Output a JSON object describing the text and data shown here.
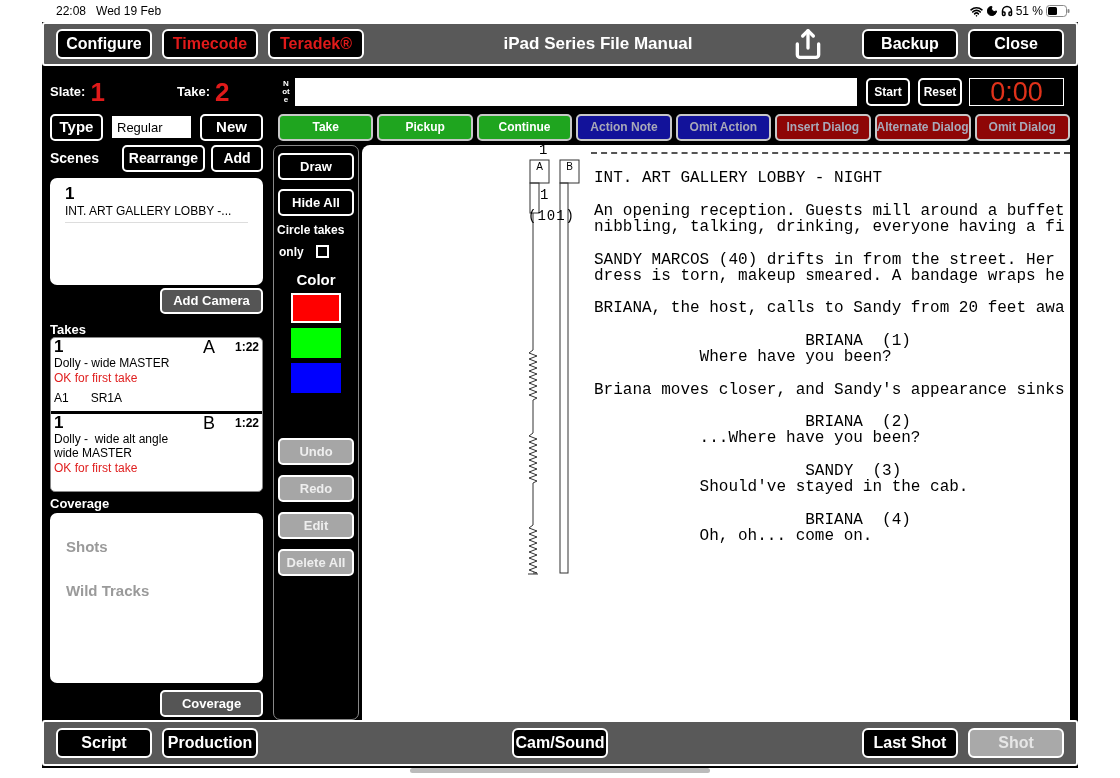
{
  "status_bar": {
    "time": "22:08",
    "date": "Wed 19 Feb",
    "battery": "51 %"
  },
  "toolbar": {
    "left_buttons": [
      {
        "label": "Configure",
        "alert": false
      },
      {
        "label": "Timecode",
        "alert": true
      },
      {
        "label": "Teradek®",
        "alert": true
      }
    ],
    "title": "iPad Series File Manual",
    "right_buttons": [
      "Backup",
      "Close"
    ]
  },
  "slate": {
    "label": "Slate:",
    "value": "1"
  },
  "take": {
    "label": "Take:",
    "value": "2"
  },
  "note": {
    "label": "Note"
  },
  "timer": {
    "buttons": [
      "Start",
      "Reset"
    ],
    "display": "0:00"
  },
  "type": {
    "button": "Type",
    "value": "Regular",
    "new_button": "New"
  },
  "categories": [
    {
      "label": "Take",
      "color": "#1fa51f",
      "disabled": false
    },
    {
      "label": "Pickup",
      "color": "#1fa51f",
      "disabled": false
    },
    {
      "label": "Continue",
      "color": "#1fa51f",
      "disabled": false
    },
    {
      "label": "Action Note",
      "color": "#12129a",
      "disabled": true
    },
    {
      "label": "Omit Action",
      "color": "#12129a",
      "disabled": true
    },
    {
      "label": "Insert Dialog",
      "color": "#8e0606",
      "disabled": true
    },
    {
      "label": "Alternate Dialog",
      "color": "#8e0606",
      "disabled": true
    },
    {
      "label": "Omit Dialog",
      "color": "#8e0606",
      "disabled": true
    }
  ],
  "scenes": {
    "label": "Scenes",
    "buttons": [
      "Rearrange",
      "Add"
    ],
    "items": [
      {
        "number": "1",
        "title": "INT. ART GALLERY LOBBY -..."
      }
    ],
    "add_camera": "Add Camera"
  },
  "takes": {
    "label": "Takes",
    "items": [
      {
        "scene": "1",
        "camera": "A",
        "duration": "1:22",
        "description": [
          "Dolly - wide MASTER"
        ],
        "note": "OK for first take",
        "details": [
          "A1",
          "SR1A"
        ]
      },
      {
        "scene": "1",
        "camera": "B",
        "duration": "1:22",
        "description": [
          "Dolly -  wide alt angle",
          "wide MASTER"
        ],
        "note": "OK for first take"
      }
    ]
  },
  "coverage": {
    "label": "Coverage",
    "items": [
      "Shots",
      "Wild Tracks"
    ],
    "button": "Coverage"
  },
  "tools": {
    "top_buttons": [
      "Draw",
      "Hide All"
    ],
    "circle_takes": {
      "label": "Circle takes",
      "label_2": "only",
      "checked": false
    },
    "color_label": "Color",
    "colors": [
      {
        "color": "#ff0000",
        "selected": true
      },
      {
        "color": "#00ff00",
        "selected": false
      },
      {
        "color": "#0000ff",
        "selected": false
      }
    ],
    "edit_buttons": [
      {
        "label": "Undo",
        "disabled": true
      },
      {
        "label": "Redo",
        "disabled": true
      },
      {
        "label": "Edit",
        "disabled": true
      },
      {
        "label": "Delete All",
        "disabled": true
      }
    ]
  },
  "lining": {
    "setup_number": "1",
    "columns": [
      {
        "label": "A"
      },
      {
        "label": "B"
      }
    ],
    "take_number": "1",
    "scene_number": "(101)"
  },
  "script": [
    {
      "kind": "heading",
      "lines": [
        "INT. ART GALLERY LOBBY - NIGHT"
      ]
    },
    {
      "kind": "action",
      "lines": [
        "An opening reception. Guests mill around a buffet",
        "nibbling, talking, drinking, everyone having a fi"
      ]
    },
    {
      "kind": "action",
      "lines": [
        "SANDY MARCOS (40) drifts in from the street. Her",
        "dress is torn, makeup smeared. A bandage wraps he"
      ]
    },
    {
      "kind": "action",
      "lines": [
        "BRIANA, the host, calls to Sandy from 20 feet awa"
      ]
    },
    {
      "kind": "character",
      "lines": [
        "BRIANA  (1)"
      ]
    },
    {
      "kind": "dialogue",
      "lines": [
        "Where have you been?"
      ]
    },
    {
      "kind": "action",
      "lines": [
        "Briana moves closer, and Sandy's appearance sinks"
      ]
    },
    {
      "kind": "character",
      "lines": [
        "BRIANA  (2)"
      ]
    },
    {
      "kind": "dialogue",
      "lines": [
        "...Where have you been?"
      ]
    },
    {
      "kind": "character",
      "lines": [
        "SANDY  (3)"
      ]
    },
    {
      "kind": "dialogue",
      "lines": [
        "Should've stayed in the cab."
      ]
    },
    {
      "kind": "character",
      "lines": [
        "BRIANA  (4)"
      ]
    },
    {
      "kind": "dialogue",
      "lines": [
        "Oh, oh... come on."
      ]
    }
  ],
  "bottom_bar": {
    "left": [
      {
        "label": "Script",
        "disabled": false
      },
      {
        "label": "Production",
        "disabled": false
      }
    ],
    "center": [
      {
        "label": "Cam/Sound",
        "disabled": false
      }
    ],
    "right": [
      {
        "label": "Last Shot",
        "disabled": false
      },
      {
        "label": "Shot",
        "disabled": true
      }
    ]
  }
}
